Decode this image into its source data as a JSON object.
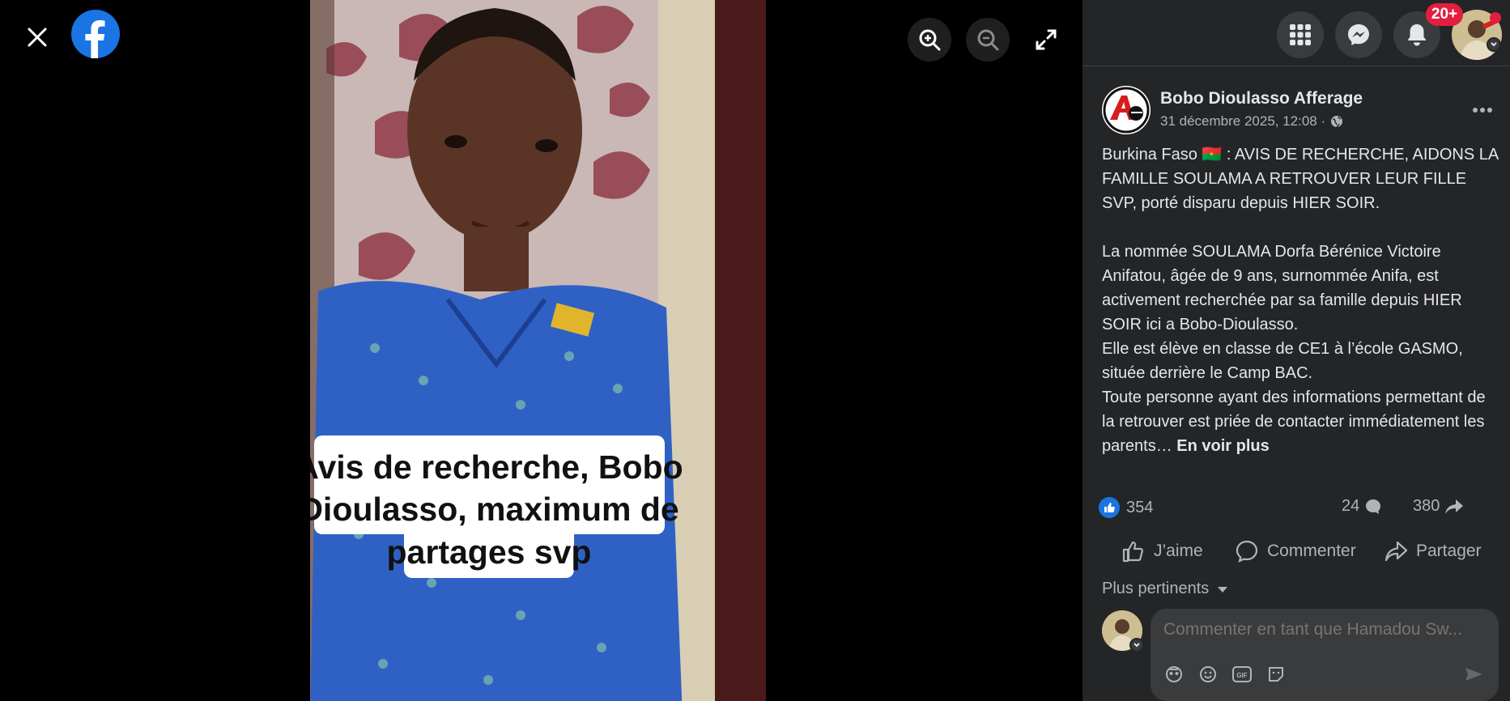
{
  "colors": {
    "accent": "#1b74e4",
    "badge": "#e41e3f",
    "panel": "#242526"
  },
  "viewer": {
    "close_icon": "close-icon",
    "logo_icon": "facebook-logo",
    "zoom_in_icon": "zoom-in-icon",
    "zoom_out_icon": "zoom-out-icon",
    "fullscreen_icon": "fullscreen-icon",
    "photo_caption": "Avis de recherche, Bobo Dioulasso, maximum de partages svp",
    "photo_caption_lines": [
      "Avis de recherche, Bobo",
      "Dioulasso, maximum de",
      "partages svp"
    ]
  },
  "topbar": {
    "menu_icon": "grid-menu-icon",
    "messenger_icon": "messenger-icon",
    "notifications_icon": "bell-icon",
    "notifications_badge": "20+",
    "account_icon": "avatar"
  },
  "post": {
    "author": "Bobo Dioulasso Afferage",
    "date": "31 décembre 2025, 12:08 ·",
    "privacy_icon": "globe-icon",
    "more_icon": "more-icon",
    "text": {
      "p1": "Burkina Faso 🇧🇫 : AVIS DE RECHERCHE, AIDONS LA FAMILLE SOULAMA A RETROUVER LEUR FILLE SVP, porté disparu depuis HIER SOIR.",
      "p2": "La nommée SOULAMA Dorfa Bérénice Victoire Anifatou, âgée de 9 ans, surnommée Anifa, est activement recherchée par sa famille depuis HIER SOIR ici a Bobo-Dioulasso.",
      "p3": "Elle est élève en classe de CE1 à l’école GASMO, située derrière le Camp BAC.",
      "p4": "Toute personne ayant des informations permettant de la retrouver est priée de contacter immédiatement les parents…",
      "see_more": "En voir plus"
    },
    "stats": {
      "likes": "354",
      "comments": "24",
      "shares": "380"
    },
    "actions": {
      "like": "J’aime",
      "comment": "Commenter",
      "share": "Partager"
    },
    "sort_label": "Plus pertinents"
  },
  "composer": {
    "placeholder": "Commenter en tant que Hamadou Sw...",
    "icons": [
      "avatar-sticker-icon",
      "emoji-icon",
      "gif-icon",
      "sticker-icon",
      "send-icon"
    ]
  }
}
